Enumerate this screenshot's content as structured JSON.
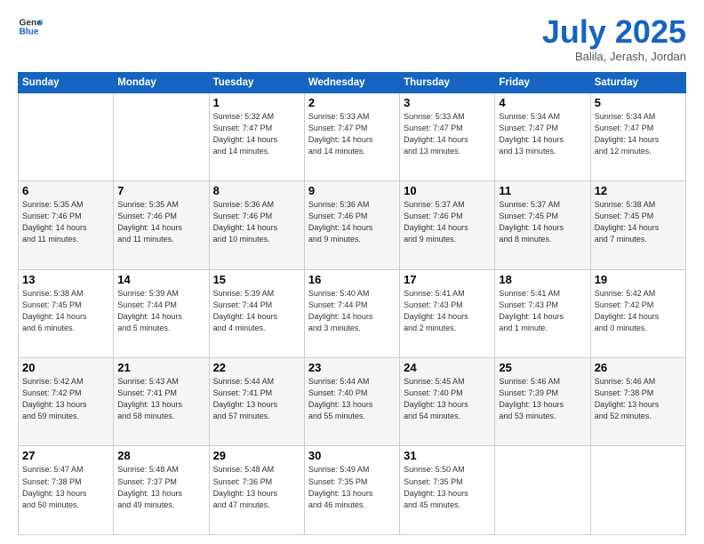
{
  "header": {
    "logo_general": "General",
    "logo_blue": "Blue",
    "month_title": "July 2025",
    "location": "Balila, Jerash, Jordan"
  },
  "weekdays": [
    "Sunday",
    "Monday",
    "Tuesday",
    "Wednesday",
    "Thursday",
    "Friday",
    "Saturday"
  ],
  "weeks": [
    [
      {
        "day": "",
        "info": ""
      },
      {
        "day": "",
        "info": ""
      },
      {
        "day": "1",
        "info": "Sunrise: 5:32 AM\nSunset: 7:47 PM\nDaylight: 14 hours\nand 14 minutes."
      },
      {
        "day": "2",
        "info": "Sunrise: 5:33 AM\nSunset: 7:47 PM\nDaylight: 14 hours\nand 14 minutes."
      },
      {
        "day": "3",
        "info": "Sunrise: 5:33 AM\nSunset: 7:47 PM\nDaylight: 14 hours\nand 13 minutes."
      },
      {
        "day": "4",
        "info": "Sunrise: 5:34 AM\nSunset: 7:47 PM\nDaylight: 14 hours\nand 13 minutes."
      },
      {
        "day": "5",
        "info": "Sunrise: 5:34 AM\nSunset: 7:47 PM\nDaylight: 14 hours\nand 12 minutes."
      }
    ],
    [
      {
        "day": "6",
        "info": "Sunrise: 5:35 AM\nSunset: 7:46 PM\nDaylight: 14 hours\nand 11 minutes."
      },
      {
        "day": "7",
        "info": "Sunrise: 5:35 AM\nSunset: 7:46 PM\nDaylight: 14 hours\nand 11 minutes."
      },
      {
        "day": "8",
        "info": "Sunrise: 5:36 AM\nSunset: 7:46 PM\nDaylight: 14 hours\nand 10 minutes."
      },
      {
        "day": "9",
        "info": "Sunrise: 5:36 AM\nSunset: 7:46 PM\nDaylight: 14 hours\nand 9 minutes."
      },
      {
        "day": "10",
        "info": "Sunrise: 5:37 AM\nSunset: 7:46 PM\nDaylight: 14 hours\nand 9 minutes."
      },
      {
        "day": "11",
        "info": "Sunrise: 5:37 AM\nSunset: 7:45 PM\nDaylight: 14 hours\nand 8 minutes."
      },
      {
        "day": "12",
        "info": "Sunrise: 5:38 AM\nSunset: 7:45 PM\nDaylight: 14 hours\nand 7 minutes."
      }
    ],
    [
      {
        "day": "13",
        "info": "Sunrise: 5:38 AM\nSunset: 7:45 PM\nDaylight: 14 hours\nand 6 minutes."
      },
      {
        "day": "14",
        "info": "Sunrise: 5:39 AM\nSunset: 7:44 PM\nDaylight: 14 hours\nand 5 minutes."
      },
      {
        "day": "15",
        "info": "Sunrise: 5:39 AM\nSunset: 7:44 PM\nDaylight: 14 hours\nand 4 minutes."
      },
      {
        "day": "16",
        "info": "Sunrise: 5:40 AM\nSunset: 7:44 PM\nDaylight: 14 hours\nand 3 minutes."
      },
      {
        "day": "17",
        "info": "Sunrise: 5:41 AM\nSunset: 7:43 PM\nDaylight: 14 hours\nand 2 minutes."
      },
      {
        "day": "18",
        "info": "Sunrise: 5:41 AM\nSunset: 7:43 PM\nDaylight: 14 hours\nand 1 minute."
      },
      {
        "day": "19",
        "info": "Sunrise: 5:42 AM\nSunset: 7:42 PM\nDaylight: 14 hours\nand 0 minutes."
      }
    ],
    [
      {
        "day": "20",
        "info": "Sunrise: 5:42 AM\nSunset: 7:42 PM\nDaylight: 13 hours\nand 59 minutes."
      },
      {
        "day": "21",
        "info": "Sunrise: 5:43 AM\nSunset: 7:41 PM\nDaylight: 13 hours\nand 58 minutes."
      },
      {
        "day": "22",
        "info": "Sunrise: 5:44 AM\nSunset: 7:41 PM\nDaylight: 13 hours\nand 57 minutes."
      },
      {
        "day": "23",
        "info": "Sunrise: 5:44 AM\nSunset: 7:40 PM\nDaylight: 13 hours\nand 55 minutes."
      },
      {
        "day": "24",
        "info": "Sunrise: 5:45 AM\nSunset: 7:40 PM\nDaylight: 13 hours\nand 54 minutes."
      },
      {
        "day": "25",
        "info": "Sunrise: 5:46 AM\nSunset: 7:39 PM\nDaylight: 13 hours\nand 53 minutes."
      },
      {
        "day": "26",
        "info": "Sunrise: 5:46 AM\nSunset: 7:38 PM\nDaylight: 13 hours\nand 52 minutes."
      }
    ],
    [
      {
        "day": "27",
        "info": "Sunrise: 5:47 AM\nSunset: 7:38 PM\nDaylight: 13 hours\nand 50 minutes."
      },
      {
        "day": "28",
        "info": "Sunrise: 5:48 AM\nSunset: 7:37 PM\nDaylight: 13 hours\nand 49 minutes."
      },
      {
        "day": "29",
        "info": "Sunrise: 5:48 AM\nSunset: 7:36 PM\nDaylight: 13 hours\nand 47 minutes."
      },
      {
        "day": "30",
        "info": "Sunrise: 5:49 AM\nSunset: 7:35 PM\nDaylight: 13 hours\nand 46 minutes."
      },
      {
        "day": "31",
        "info": "Sunrise: 5:50 AM\nSunset: 7:35 PM\nDaylight: 13 hours\nand 45 minutes."
      },
      {
        "day": "",
        "info": ""
      },
      {
        "day": "",
        "info": ""
      }
    ]
  ]
}
